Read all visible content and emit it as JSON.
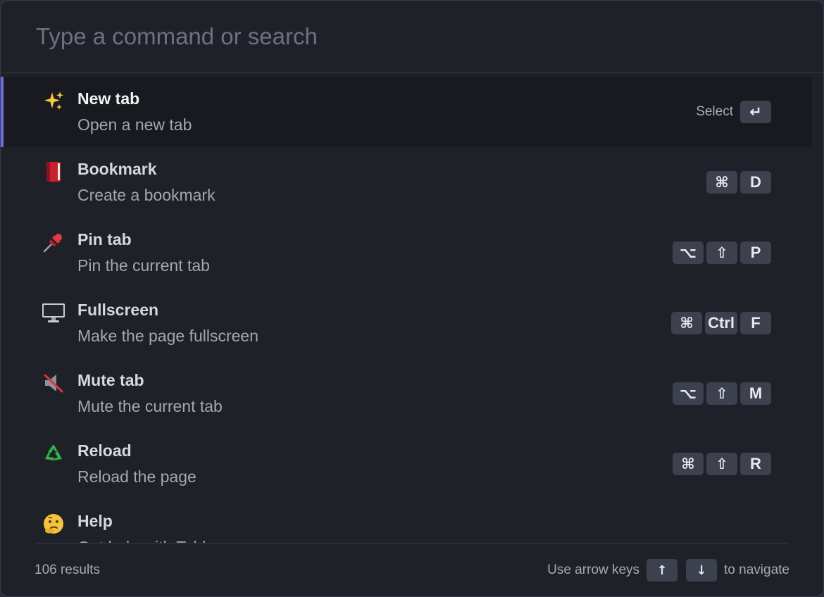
{
  "search": {
    "placeholder": "Type a command or search"
  },
  "commands": [
    {
      "title": "New tab",
      "description": "Open a new tab",
      "icon": "sparkles-icon"
    },
    {
      "title": "Bookmark",
      "description": "Create a bookmark",
      "icon": "book-icon"
    },
    {
      "title": "Pin tab",
      "description": "Pin the current tab",
      "icon": "pushpin-icon"
    },
    {
      "title": "Fullscreen",
      "description": "Make the page fullscreen",
      "icon": "desktop-computer-icon"
    },
    {
      "title": "Mute tab",
      "description": "Mute the current tab",
      "icon": "muted-speaker-icon"
    },
    {
      "title": "Reload",
      "description": "Reload the page",
      "icon": "recycle-icon"
    },
    {
      "title": "Help",
      "description": "Get help with Tabby",
      "icon": "thinking-face-icon"
    }
  ],
  "shortcuts": {
    "select_label": "Select",
    "select_key": "↵",
    "bookmark": [
      "⌘",
      "D"
    ],
    "pin": [
      "⌥",
      "⇧",
      "P"
    ],
    "fullscreen": [
      "⌘",
      "Ctrl",
      "F"
    ],
    "mute": [
      "⌥",
      "⇧",
      "M"
    ],
    "reload": [
      "⌘",
      "⇧",
      "R"
    ]
  },
  "footer": {
    "results": "106 results",
    "hint_prefix": "Use arrow keys",
    "up_key": "↑",
    "down_key": "↓",
    "hint_suffix": "to navigate"
  },
  "colors": {
    "accent": "#6c6ee2",
    "background": "#1f2129",
    "active_row": "#181a20",
    "key_bg": "#3d414d"
  }
}
